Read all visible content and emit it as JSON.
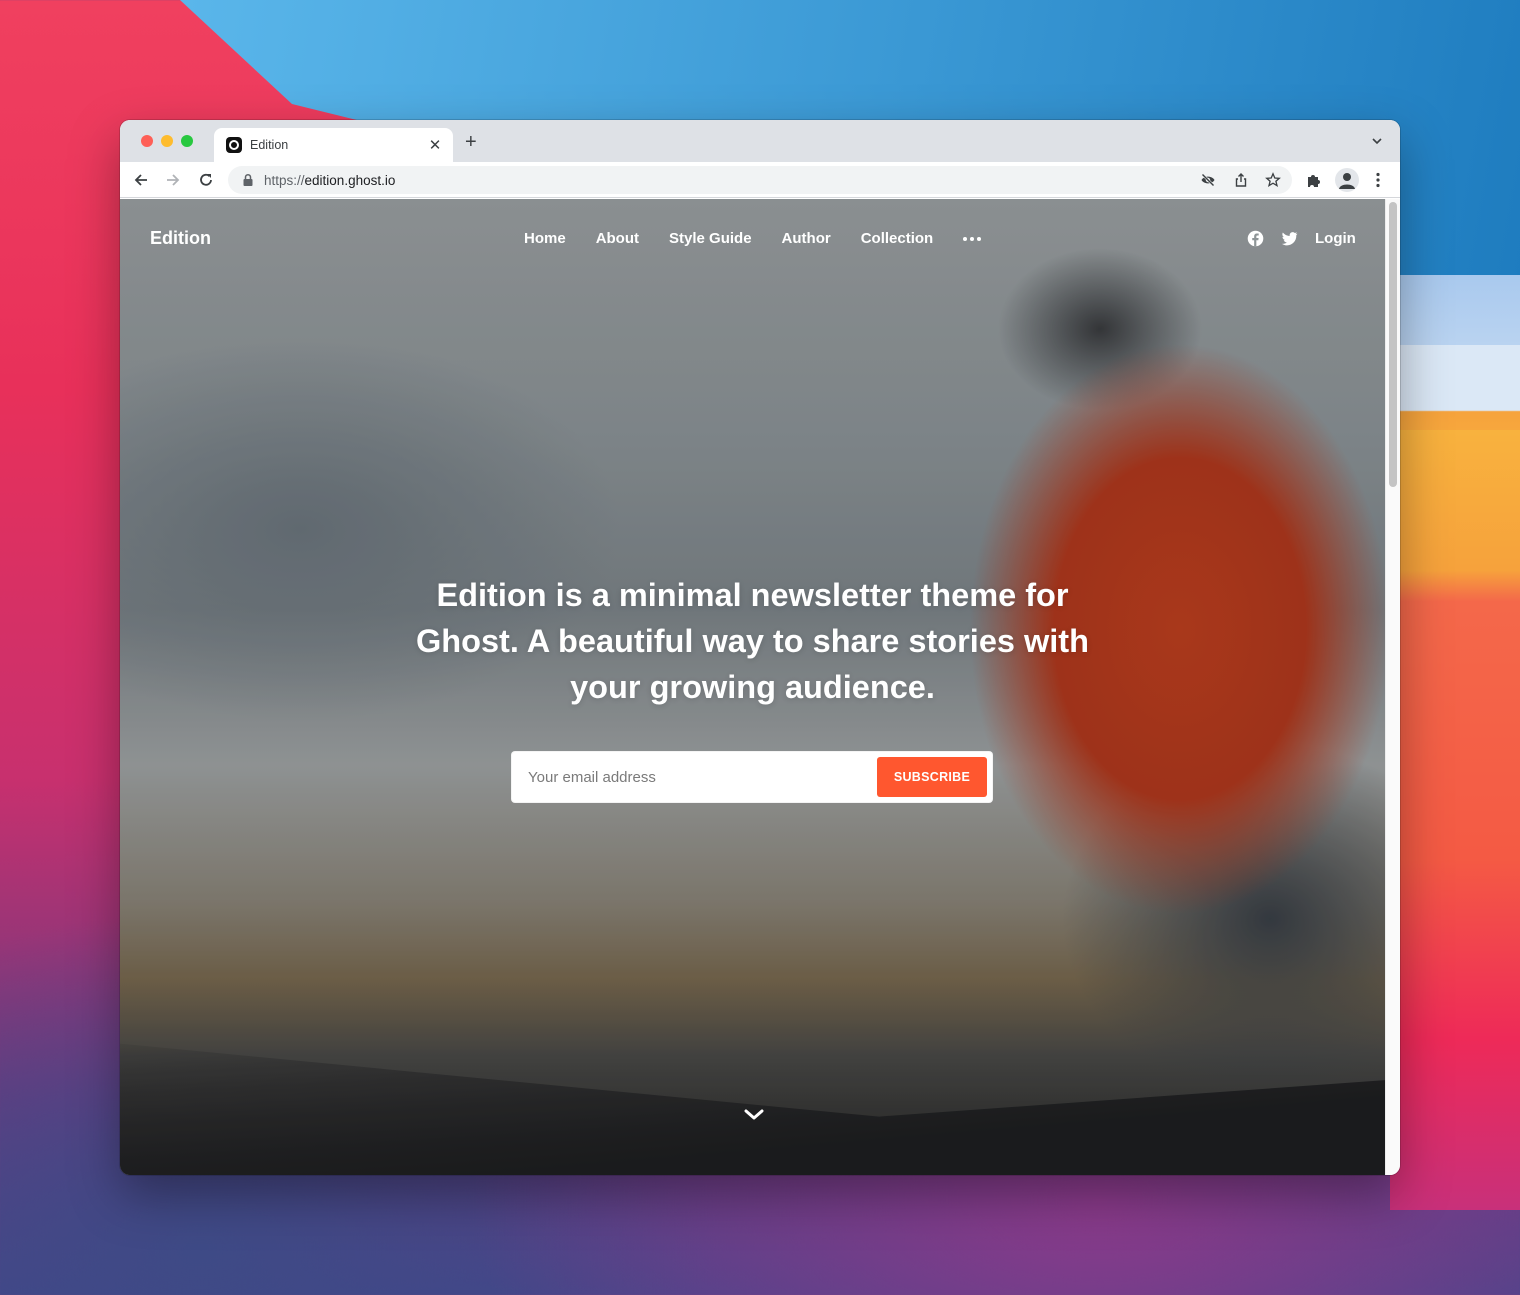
{
  "browser": {
    "tab": {
      "title": "Edition",
      "favicon": "ghost-edition-icon"
    },
    "new_tab_label": "+",
    "address": {
      "scheme": "https://",
      "host": "edition.ghost.io"
    },
    "icons": [
      "back-icon",
      "forward-icon",
      "reload-icon",
      "lock-icon",
      "eye-slash-icon",
      "share-icon",
      "star-icon",
      "extensions-icon",
      "profile-icon",
      "kebab-menu-icon",
      "tab-search-icon"
    ]
  },
  "site": {
    "logo": "Edition",
    "nav": [
      {
        "label": "Home"
      },
      {
        "label": "About"
      },
      {
        "label": "Style Guide"
      },
      {
        "label": "Author"
      },
      {
        "label": "Collection"
      }
    ],
    "more_icon": "ellipsis-icon",
    "social": [
      "facebook-icon",
      "twitter-icon"
    ],
    "login": "Login"
  },
  "hero": {
    "headline": "Edition is a minimal newsletter theme for Ghost. A beautiful way to share stories with your growing audience.",
    "email_placeholder": "Your email address",
    "email_value": "",
    "subscribe_label": "SUBSCRIBE",
    "accent_color": "#ff572f",
    "scroll_icon": "chevron-down-icon"
  }
}
